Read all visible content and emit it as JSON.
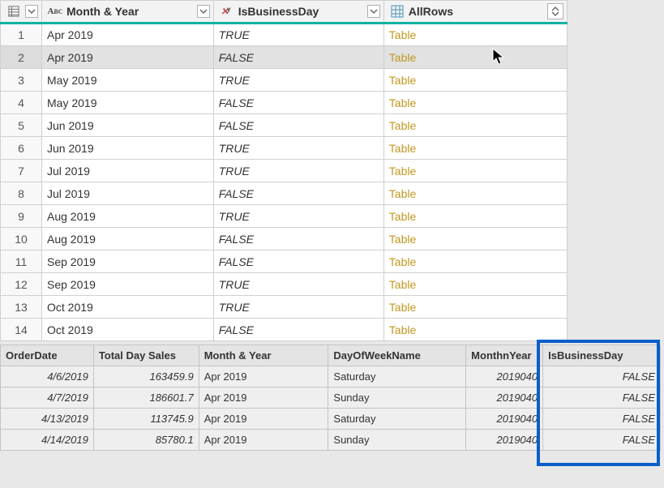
{
  "mainTable": {
    "headers": {
      "month_year": "Month & Year",
      "is_business_day": "IsBusinessDay",
      "all_rows": "AllRows"
    },
    "rows": [
      {
        "n": "1",
        "month": "Apr 2019",
        "biz": "TRUE",
        "all": "Table"
      },
      {
        "n": "2",
        "month": "Apr 2019",
        "biz": "FALSE",
        "all": "Table",
        "selected": true
      },
      {
        "n": "3",
        "month": "May 2019",
        "biz": "TRUE",
        "all": "Table"
      },
      {
        "n": "4",
        "month": "May 2019",
        "biz": "FALSE",
        "all": "Table"
      },
      {
        "n": "5",
        "month": "Jun 2019",
        "biz": "FALSE",
        "all": "Table"
      },
      {
        "n": "6",
        "month": "Jun 2019",
        "biz": "TRUE",
        "all": "Table"
      },
      {
        "n": "7",
        "month": "Jul 2019",
        "biz": "TRUE",
        "all": "Table"
      },
      {
        "n": "8",
        "month": "Jul 2019",
        "biz": "FALSE",
        "all": "Table"
      },
      {
        "n": "9",
        "month": "Aug 2019",
        "biz": "TRUE",
        "all": "Table"
      },
      {
        "n": "10",
        "month": "Aug 2019",
        "biz": "FALSE",
        "all": "Table"
      },
      {
        "n": "11",
        "month": "Sep 2019",
        "biz": "FALSE",
        "all": "Table"
      },
      {
        "n": "12",
        "month": "Sep 2019",
        "biz": "TRUE",
        "all": "Table"
      },
      {
        "n": "13",
        "month": "Oct 2019",
        "biz": "TRUE",
        "all": "Table"
      },
      {
        "n": "14",
        "month": "Oct 2019",
        "biz": "FALSE",
        "all": "Table"
      }
    ]
  },
  "preview": {
    "headers": {
      "order_date": "OrderDate",
      "total_sales": "Total Day Sales",
      "month_year": "Month & Year",
      "dow": "DayOfWeekName",
      "monthn_year": "MonthnYear",
      "is_biz": "IsBusinessDay"
    },
    "rows": [
      {
        "order": "4/6/2019",
        "sales": "163459.9",
        "month": "Apr 2019",
        "dow": "Saturday",
        "my": "2019040",
        "biz": "FALSE"
      },
      {
        "order": "4/7/2019",
        "sales": "186601.7",
        "month": "Apr 2019",
        "dow": "Sunday",
        "my": "2019040",
        "biz": "FALSE"
      },
      {
        "order": "4/13/2019",
        "sales": "113745.9",
        "month": "Apr 2019",
        "dow": "Saturday",
        "my": "2019040",
        "biz": "FALSE"
      },
      {
        "order": "4/14/2019",
        "sales": "85780.1",
        "month": "Apr 2019",
        "dow": "Sunday",
        "my": "2019040",
        "biz": "FALSE"
      }
    ]
  },
  "icons": {
    "abc_text": "A",
    "abc_b": "B",
    "abc_c": "C"
  }
}
